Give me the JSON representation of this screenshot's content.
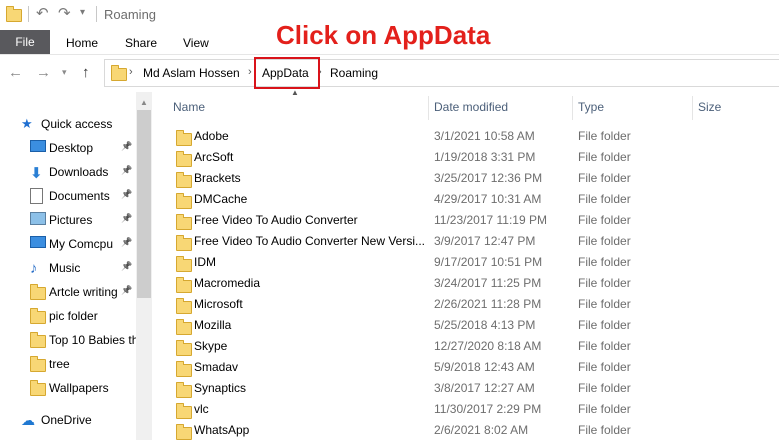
{
  "window": {
    "title": "Roaming"
  },
  "headline": "Click on AppData",
  "menu": {
    "file": "File",
    "home": "Home",
    "share": "Share",
    "view": "View"
  },
  "breadcrumbs": [
    "Md Aslam Hossen",
    "AppData",
    "Roaming"
  ],
  "sidebar": {
    "items": [
      {
        "label": "Quick access",
        "icon": "star-icon",
        "pinned": false
      },
      {
        "label": "Desktop",
        "icon": "desktop-icon",
        "pinned": true
      },
      {
        "label": "Downloads",
        "icon": "download-icon",
        "pinned": true
      },
      {
        "label": "Documents",
        "icon": "document-icon",
        "pinned": true
      },
      {
        "label": "Pictures",
        "icon": "picture-icon",
        "pinned": true
      },
      {
        "label": "My  Comcpu",
        "icon": "computer-icon",
        "pinned": true
      },
      {
        "label": "Music",
        "icon": "music-icon",
        "pinned": true
      },
      {
        "label": "Artcle writing",
        "icon": "folder-icon",
        "pinned": true
      },
      {
        "label": "pic folder",
        "icon": "folder-icon",
        "pinned": false
      },
      {
        "label": "Top 10 Babies th",
        "icon": "folder-icon",
        "pinned": false
      },
      {
        "label": "tree",
        "icon": "folder-icon",
        "pinned": false
      },
      {
        "label": "Wallpapers",
        "icon": "folder-icon",
        "pinned": false
      },
      {
        "label": "OneDrive",
        "icon": "cloud-icon",
        "pinned": false
      }
    ]
  },
  "columns": {
    "name": "Name",
    "date": "Date modified",
    "type": "Type",
    "size": "Size"
  },
  "files": [
    {
      "name": "Adobe",
      "date": "3/1/2021 10:58 AM",
      "type": "File folder"
    },
    {
      "name": "ArcSoft",
      "date": "1/19/2018 3:31 PM",
      "type": "File folder"
    },
    {
      "name": "Brackets",
      "date": "3/25/2017 12:36 PM",
      "type": "File folder"
    },
    {
      "name": "DMCache",
      "date": "4/29/2017 10:31 AM",
      "type": "File folder"
    },
    {
      "name": "Free Video To Audio Converter",
      "date": "11/23/2017 11:19 PM",
      "type": "File folder"
    },
    {
      "name": "Free Video To Audio Converter New Versi...",
      "date": "3/9/2017 12:47 PM",
      "type": "File folder"
    },
    {
      "name": "IDM",
      "date": "9/17/2017 10:51 PM",
      "type": "File folder"
    },
    {
      "name": "Macromedia",
      "date": "3/24/2017 11:25 PM",
      "type": "File folder"
    },
    {
      "name": "Microsoft",
      "date": "2/26/2021 11:28 PM",
      "type": "File folder"
    },
    {
      "name": "Mozilla",
      "date": "5/25/2018 4:13 PM",
      "type": "File folder"
    },
    {
      "name": "Skype",
      "date": "12/27/2020 8:18 AM",
      "type": "File folder"
    },
    {
      "name": "Smadav",
      "date": "5/9/2018 12:43 AM",
      "type": "File folder"
    },
    {
      "name": "Synaptics",
      "date": "3/8/2017 12:27 AM",
      "type": "File folder"
    },
    {
      "name": "vlc",
      "date": "11/30/2017 2:29 PM",
      "type": "File folder"
    },
    {
      "name": "WhatsApp",
      "date": "2/6/2021 8:02 AM",
      "type": "File folder"
    }
  ],
  "colors": {
    "headline": "#e3201b",
    "highlight_box": "#d9131a",
    "file_tab": "#59595d",
    "folder": "#f8d775"
  }
}
